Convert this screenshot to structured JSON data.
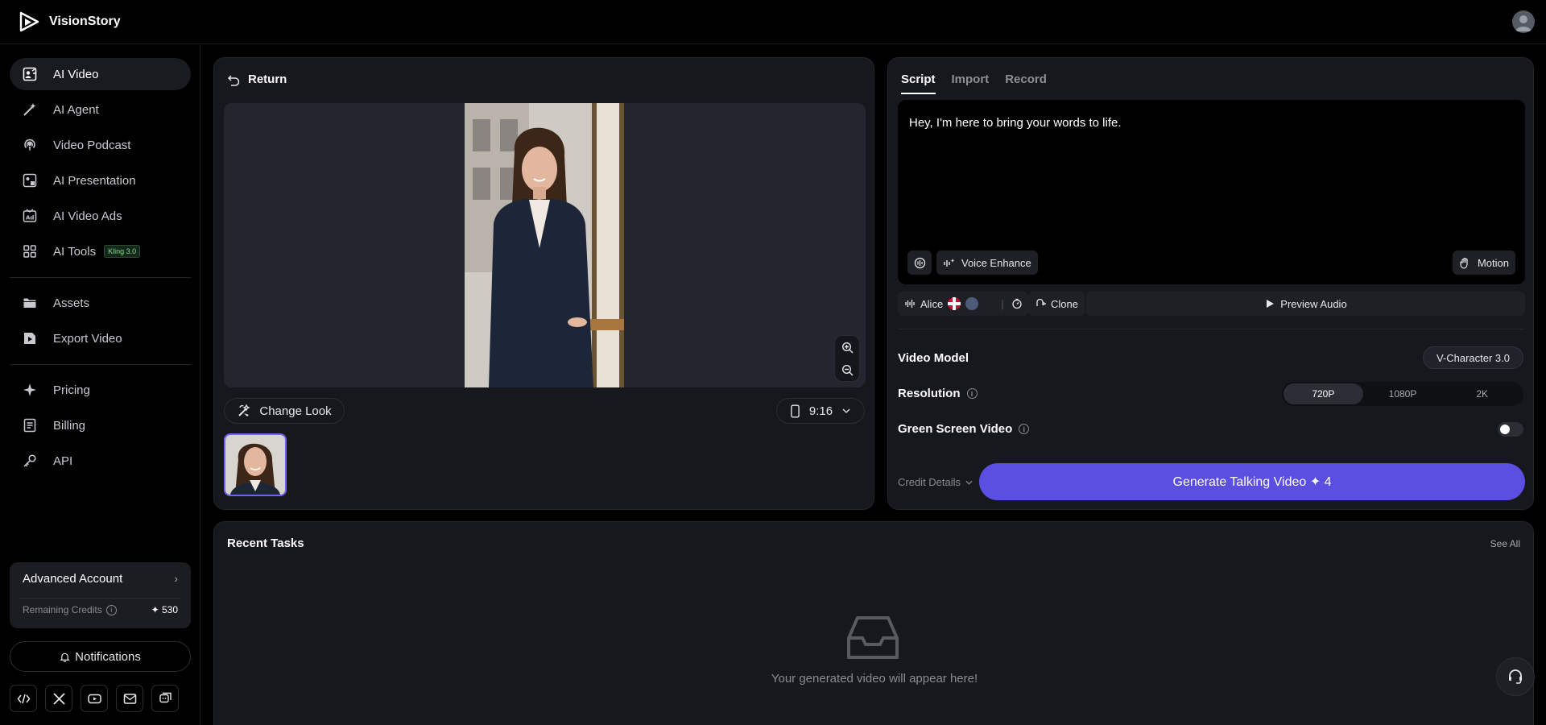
{
  "app": {
    "name": "VisionStory"
  },
  "sidebar": {
    "items": [
      {
        "label": "AI Video",
        "icon": "ai-video-icon",
        "active": true
      },
      {
        "label": "AI Agent",
        "icon": "magic-wand-icon"
      },
      {
        "label": "Video Podcast",
        "icon": "podcast-icon"
      },
      {
        "label": "AI Presentation",
        "icon": "presentation-icon"
      },
      {
        "label": "AI Video Ads",
        "icon": "ads-icon"
      },
      {
        "label": "AI Tools",
        "icon": "grid-icon",
        "badge": "Kling 3.0"
      },
      {
        "label": "Assets",
        "icon": "folder-icon"
      },
      {
        "label": "Export Video",
        "icon": "export-icon"
      },
      {
        "label": "Pricing",
        "icon": "sparkle-icon"
      },
      {
        "label": "Billing",
        "icon": "receipt-icon"
      },
      {
        "label": "API",
        "icon": "key-icon"
      }
    ],
    "account": {
      "title": "Advanced Account",
      "remaining_label": "Remaining Credits",
      "credits": "✦ 530"
    },
    "notifications_label": "Notifications",
    "social": [
      "code-icon",
      "x-icon",
      "youtube-icon",
      "mail-icon",
      "discord-icon"
    ]
  },
  "editor": {
    "return_label": "Return",
    "change_look_label": "Change Look",
    "aspect_ratio": "9:16"
  },
  "script_panel": {
    "tabs": [
      "Script",
      "Import",
      "Record"
    ],
    "active_tab": "Script",
    "script_text": "Hey, I'm here to bring your words to life.",
    "voice_enhance_label": "Voice Enhance",
    "motion_label": "Motion",
    "voice_name": "Alice",
    "clone_label": "Clone",
    "preview_audio_label": "Preview Audio",
    "video_model_label": "Video Model",
    "video_model_value": "V-Character 3.0",
    "resolution_label": "Resolution",
    "resolution_options": [
      "720P",
      "1080P",
      "2K"
    ],
    "resolution_selected": "720P",
    "green_screen_label": "Green Screen Video",
    "green_screen_on": false,
    "credit_details_label": "Credit Details",
    "generate_label": "Generate Talking Video ✦ 4"
  },
  "recent": {
    "title": "Recent Tasks",
    "see_all_label": "See All",
    "empty_text": "Your generated video will appear here!"
  },
  "colors": {
    "accent": "#5a4fe0",
    "thumb_border": "#6f63f2",
    "badge_green": "#7be08a"
  }
}
